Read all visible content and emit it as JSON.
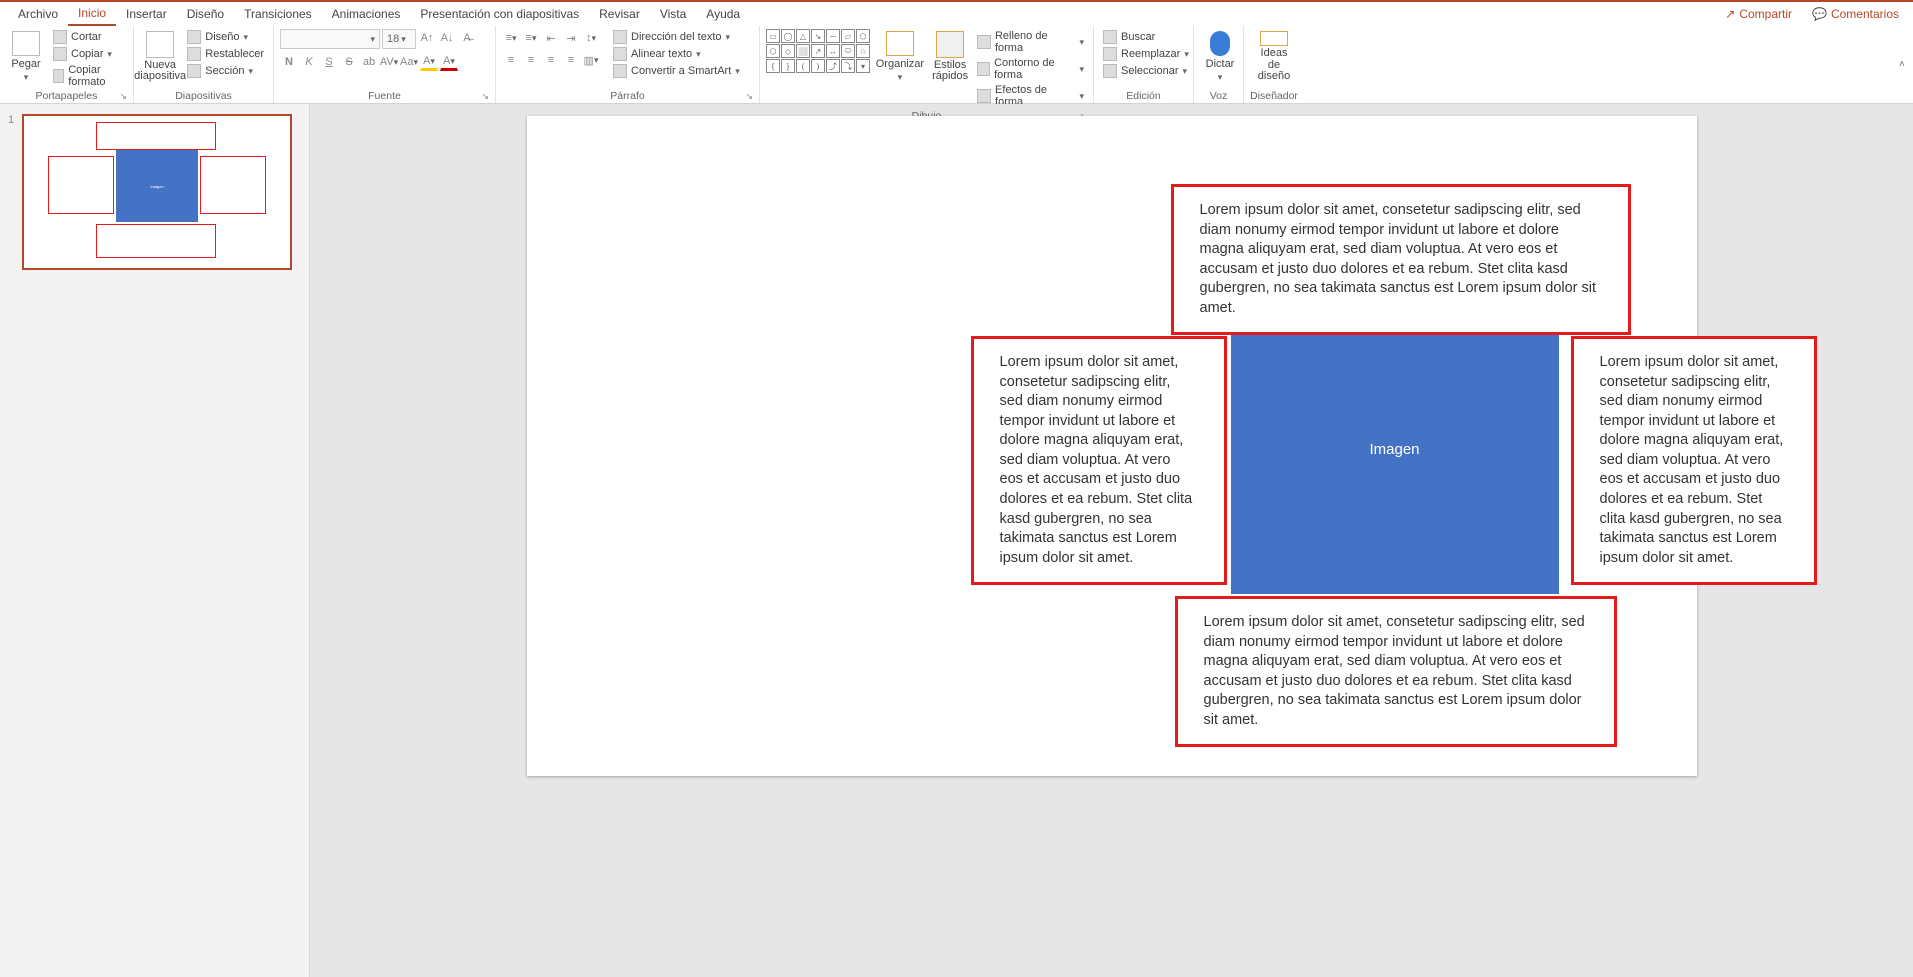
{
  "menu": {
    "tabs": [
      "Archivo",
      "Inicio",
      "Insertar",
      "Diseño",
      "Transiciones",
      "Animaciones",
      "Presentación con diapositivas",
      "Revisar",
      "Vista",
      "Ayuda"
    ],
    "active_index": 1,
    "share": "Compartir",
    "comments": "Comentarios"
  },
  "ribbon": {
    "clipboard": {
      "label": "Portapapeles",
      "paste": "Pegar",
      "cut": "Cortar",
      "copy": "Copiar",
      "format_painter": "Copiar formato"
    },
    "slides": {
      "label": "Diapositivas",
      "new_slide": "Nueva\ndiapositiva",
      "layout": "Diseño",
      "reset": "Restablecer",
      "section": "Sección"
    },
    "font": {
      "label": "Fuente",
      "font_name": "",
      "font_size": "18",
      "bold": "N",
      "italic": "K",
      "underline": "S",
      "strike": "S",
      "shadow": "ab",
      "spacing": "AV",
      "case": "Aa",
      "clear": "A"
    },
    "paragraph": {
      "label": "Párrafo",
      "text_direction": "Dirección del texto",
      "align_text": "Alinear texto",
      "smartart": "Convertir a SmartArt"
    },
    "drawing": {
      "label": "Dibujo",
      "arrange": "Organizar",
      "quick_styles": "Estilos\nrápidos",
      "shape_fill": "Relleno de forma",
      "shape_outline": "Contorno de forma",
      "shape_effects": "Efectos de forma"
    },
    "editing": {
      "label": "Edición",
      "find": "Buscar",
      "replace": "Reemplazar",
      "select": "Seleccionar"
    },
    "voice": {
      "label": "Voz",
      "dictate": "Dictar"
    },
    "designer": {
      "label": "Diseñador",
      "ideas": "Ideas de\ndiseño"
    }
  },
  "slide_panel": {
    "slide_number": "1"
  },
  "slide_content": {
    "lorem": "Lorem ipsum dolor sit amet, consetetur sadipscing elitr, sed diam nonumy eirmod tempor invidunt ut labore et dolore magna aliquyam erat, sed diam voluptua. At vero eos et accusam et justo duo dolores et ea rebum. Stet clita kasd gubergren, no sea takimata sanctus est Lorem ipsum dolor sit amet.",
    "image_label": "Imagen"
  }
}
